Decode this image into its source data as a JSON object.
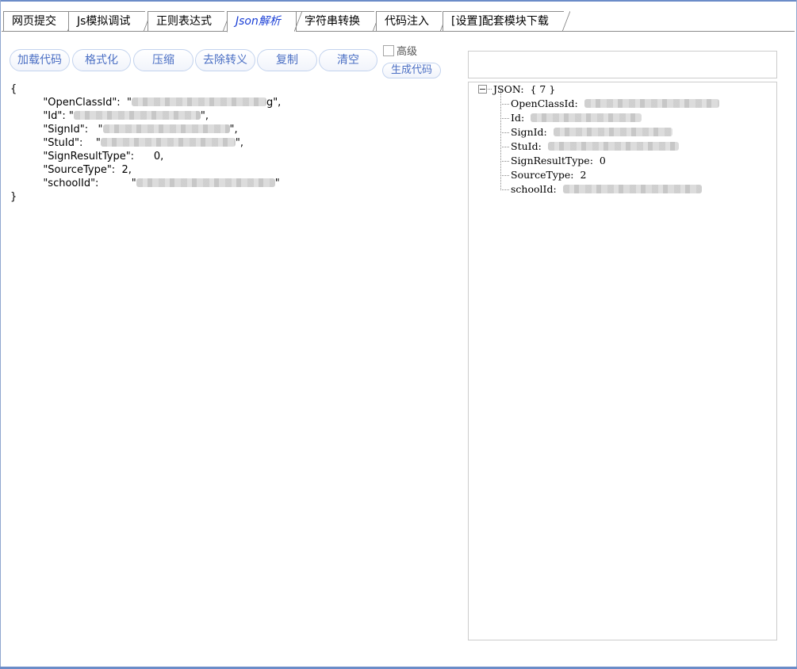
{
  "tabs": [
    {
      "label": "网页提交",
      "active": false
    },
    {
      "label": "Js模拟调试",
      "active": false
    },
    {
      "label": "正则表达式",
      "active": false
    },
    {
      "label": "Json解析",
      "active": true
    },
    {
      "label": "字符串转换",
      "active": false
    },
    {
      "label": "代码注入",
      "active": false
    },
    {
      "label": "[设置]配套模块下载",
      "active": false
    }
  ],
  "toolbar": {
    "load_code": "加载代码",
    "format": "格式化",
    "compress": "压缩",
    "unescape": "去除转义",
    "copy": "复制",
    "clear": "清空",
    "advanced_label": "高级",
    "advanced_checked": false,
    "generate_code": "生成代码"
  },
  "json_source": {
    "open_brace": "{",
    "close_brace": "}",
    "fields": [
      {
        "key": "\"OpenClassId\":",
        "value_visible": "\"",
        "value_tail": "g\",",
        "redacted": true
      },
      {
        "key": "\"Id\":",
        "value_visible": "\"",
        "value_tail": "\",",
        "redacted": true
      },
      {
        "key": "\"SignId\":",
        "value_visible": "\"",
        "value_tail": "\",",
        "redacted": true
      },
      {
        "key": "\"StuId\":",
        "value_visible": "\"",
        "value_tail": "\",",
        "redacted": true
      },
      {
        "key": "\"SignResultType\":",
        "value_visible": "0,",
        "value_tail": "",
        "redacted": false
      },
      {
        "key": "\"SourceType\":",
        "value_visible": "2,",
        "value_tail": "",
        "redacted": false
      },
      {
        "key": "\"schoolId\":",
        "value_visible": "\"",
        "value_tail": "\"",
        "redacted": true
      }
    ]
  },
  "search": {
    "value": ""
  },
  "tree": {
    "root_label": "JSON:",
    "root_count": "{ 7 }",
    "nodes": [
      {
        "key": "OpenClassId:",
        "value": "",
        "redacted": true
      },
      {
        "key": "Id:",
        "value": "",
        "redacted": true
      },
      {
        "key": "SignId:",
        "value": "",
        "redacted": true
      },
      {
        "key": "StuId:",
        "value": "",
        "redacted": true
      },
      {
        "key": "SignResultType:",
        "value": "0",
        "redacted": false
      },
      {
        "key": "SourceType:",
        "value": "2",
        "redacted": false
      },
      {
        "key": "schoolId:",
        "value": "",
        "redacted": true
      }
    ]
  }
}
